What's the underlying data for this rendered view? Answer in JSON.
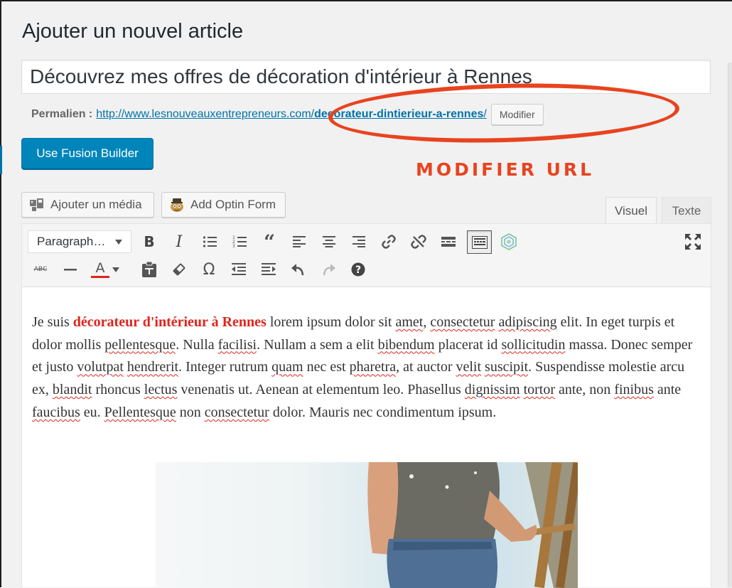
{
  "page": {
    "title": "Ajouter un nouvel article"
  },
  "post": {
    "title": "Découvrez mes offres de décoration d'intérieur à Rennes"
  },
  "permalink": {
    "label": "Permalien :",
    "url_base": "http://www.lesnouveauxentrepreneurs.com/",
    "url_slug": "decorateur-dintierieur-a-rennes",
    "url_trailing": "/",
    "modify_label": "Modifier"
  },
  "annotation": {
    "text": "MODIFIER URL",
    "color": "#e8431f"
  },
  "fusion": {
    "label": "Use Fusion Builder"
  },
  "media_buttons": {
    "add_media": "Ajouter un média",
    "add_optin": "Add Optin Form"
  },
  "tabs": {
    "visual": "Visuel",
    "text": "Texte"
  },
  "toolbar": {
    "format_select": "Paragraph…",
    "row1_icons": [
      "bold-icon",
      "italic-icon",
      "bulleted-list-icon",
      "numbered-list-icon",
      "blockquote-icon",
      "align-left-icon",
      "align-center-icon",
      "align-right-icon",
      "insert-link-icon",
      "remove-link-icon",
      "read-more-icon",
      "toolbar-toggle-icon",
      "extension-logo-icon",
      "fullscreen-icon"
    ],
    "row2_icons": [
      "strikethrough-icon",
      "horizontal-line-icon",
      "text-color-icon",
      "paste-as-text-icon",
      "clear-formatting-icon",
      "special-character-icon",
      "outdent-icon",
      "indent-icon",
      "undo-icon",
      "redo-icon",
      "help-icon"
    ],
    "strike_label": "ABC",
    "bold_label": "B",
    "italic_label": "I",
    "color_label": "A",
    "omega_label": "Ω"
  },
  "content": {
    "p1_a": "Je suis ",
    "p1_kw": "décorateur d'intérieur à Rennes",
    "p1_b": " lorem ipsum dolor sit ",
    "w_amet": "amet",
    "c1": ", ",
    "w_consectetur": "consectetur",
    "c2": " ",
    "w_adipiscing": "adipiscing",
    "c3": " elit. In eget turpis et dolor mollis ",
    "w_pellentesque": "pellentesque",
    "c4": ". Nulla ",
    "w_facilisi": "facilisi",
    "c5": ". Nullam a sem a elit ",
    "w_bibendum": "bibendum",
    "c6": " placerat id ",
    "w_sollicitudin": "sollicitudin",
    "c7": " massa. Donec semper et justo ",
    "w_volutpat": "volutpat",
    "c8": " ",
    "w_hendrerit": "hendrerit",
    "c9": ". Integer rutrum ",
    "w_quam": "quam",
    "c10": " nec est ",
    "w_pharetra": "pharetra",
    "c11": ", at auctor ",
    "w_velit": "velit",
    "c12": " ",
    "w_suscipit": "suscipit",
    "c13": ". Suspendisse molestie arcu ex, ",
    "w_blandit": "blandit",
    "c14": " rhoncus ",
    "w_lectus": "lectus",
    "c15": " venenatis ut. Aenean at elementum leo. Phasellus ",
    "w_dignissim": "dignissim",
    "c16": " ",
    "w_tortor": "tortor",
    "c17": " ante, non ",
    "w_finibus": "finibus",
    "c18": " ante ",
    "w_faucibus": "faucibus",
    "c19": " eu. ",
    "w_Pellentesque": "Pellentesque",
    "c20": " non ",
    "w_consectetur2": "consectetur",
    "c21": " dolor. Mauris nec condimentum ipsum."
  },
  "colors": {
    "primary_button": "#0085ba",
    "link": "#0073aa",
    "keyword": "#e0241c"
  }
}
